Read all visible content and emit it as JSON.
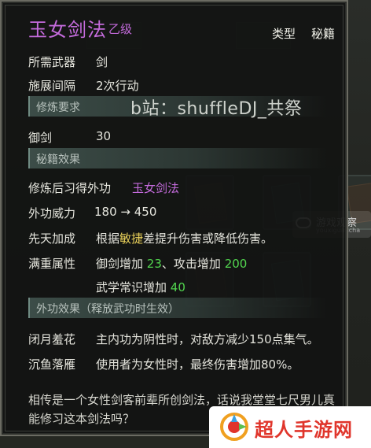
{
  "skill": {
    "name": "玉女剑法",
    "grade": "乙级",
    "type_label": "类型",
    "type_value": "秘籍"
  },
  "stats": {
    "weapon_key": "所需武器",
    "weapon_val": "剑",
    "interval_key": "施展间隔",
    "interval_val": "2次行动"
  },
  "training": {
    "section_title": "修炼要求",
    "req_key": "御剑",
    "req_val": "30"
  },
  "secret": {
    "section_title": "秘籍效果",
    "learn_key": "修炼后习得外功",
    "learn_val": "玉女剑法",
    "power_key": "外功威力",
    "power_val": "180 → 450",
    "innate_key": "先天加成",
    "innate_pre": "根据",
    "innate_hl": "敏捷",
    "innate_post": "差提升伤害或降低伤害。",
    "full_key": "满重属性",
    "full_l1_a": "御剑增加",
    "full_l1_b": "23",
    "full_l1_c": "、攻击增加",
    "full_l1_d": "200",
    "full_l2_a": "武学常识增加",
    "full_l2_b": "40"
  },
  "external": {
    "section_title": "外功效果（释放武功时生效）",
    "eff1_key": "闭月羞花",
    "eff1_val": "主内功为阴性时，对敌方减少150点集气。",
    "eff2_key": "沉鱼落雁",
    "eff2_val": "使用者为女性时，最终伤害增加80%。"
  },
  "description": "相传是一个女性剑客前辈所创剑法，话说我堂堂七尺男儿真能修习这本剑法吗？",
  "watermark": "b站：shuffleDJ_共祭",
  "side_logo": {
    "line1": "游戏观察",
    "line2": "youxiguancha"
  },
  "site_logo": {
    "text": "超人手游网"
  },
  "colors": {
    "purple": "#c46bdc",
    "green": "#52d64f",
    "yellow": "#e8d05a",
    "brand_red": "#e0352b"
  }
}
